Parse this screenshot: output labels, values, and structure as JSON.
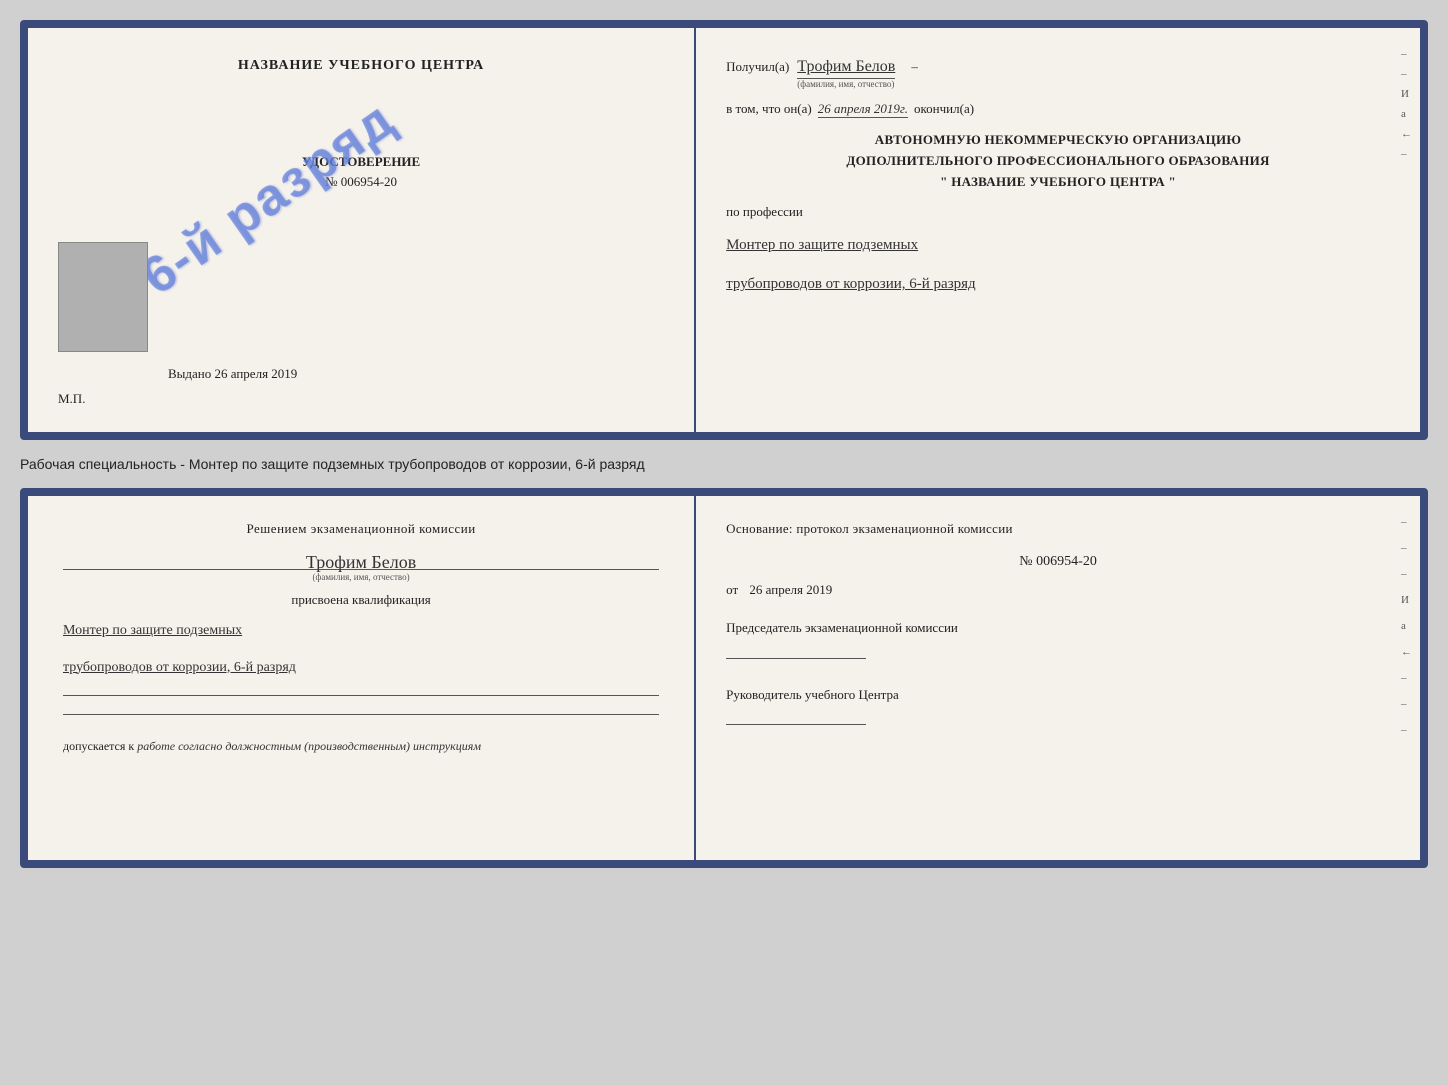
{
  "topCert": {
    "leftTitle": "НАЗВАНИЕ УЧЕБНОГО ЦЕНТРА",
    "stampText": "6-й разряд",
    "udostLabel": "УДОСТОВЕРЕНИЕ",
    "udostNumber": "№ 006954-20",
    "vydanoLabel": "Выдано",
    "vydanoDate": "26 апреля 2019",
    "mpLabel": "М.П."
  },
  "topRight": {
    "poluchilLabel": "Получил(а)",
    "recipientName": "Трофим Белов",
    "fioSubLabel": "(фамилия, имя, отчество)",
    "dashAfterName": "–",
    "vtomLabel": "в том, что он(а)",
    "completionDate": "26 апреля 2019г.",
    "okonchilLabel": "окончил(а)",
    "orgLine1": "АВТОНОМНУЮ НЕКОММЕРЧЕСКУЮ ОРГАНИЗАЦИЮ",
    "orgLine2": "ДОПОЛНИТЕЛЬНОГО ПРОФЕССИОНАЛЬНОГО ОБРАЗОВАНИЯ",
    "orgLine3": "\"  НАЗВАНИЕ УЧЕБНОГО ЦЕНТРА  \"",
    "poProfessiiLabel": "по профессии",
    "profLine1": "Монтер по защите подземных",
    "profLine2": "трубопроводов от коррозии, 6-й разряд",
    "edgeChars": [
      "–",
      "–",
      "И",
      "а",
      "←",
      "–"
    ]
  },
  "middleText": "Рабочая специальность - Монтер по защите подземных трубопроводов от коррозии, 6-й разряд",
  "bottomLeft": {
    "resheniyemText": "Решением экзаменационной комиссии",
    "personName": "Трофим Белов",
    "fioSubLabel": "(фамилия, имя, отчество)",
    "prisvoenaText": "присвоена квалификация",
    "kvalifLine1": "Монтер по защите подземных",
    "kvalifLine2": "трубопроводов от коррозии, 6-й разряд",
    "dopuskaetsyaLabel": "допускается к",
    "dopuskaetsyaValue": "работе согласно должностным (производственным) инструкциям"
  },
  "bottomRight": {
    "osnovaniLabel": "Основание: протокол экзаменационной комиссии",
    "protocolNumber": "№  006954-20",
    "otLabel": "от",
    "otDate": "26 апреля 2019",
    "predsedatelLabel": "Председатель экзаменационной комиссии",
    "rukovoditelLabel": "Руководитель учебного Центра",
    "edgeChars": [
      "–",
      "–",
      "–",
      "И",
      "а",
      "←",
      "–",
      "–",
      "–"
    ]
  }
}
